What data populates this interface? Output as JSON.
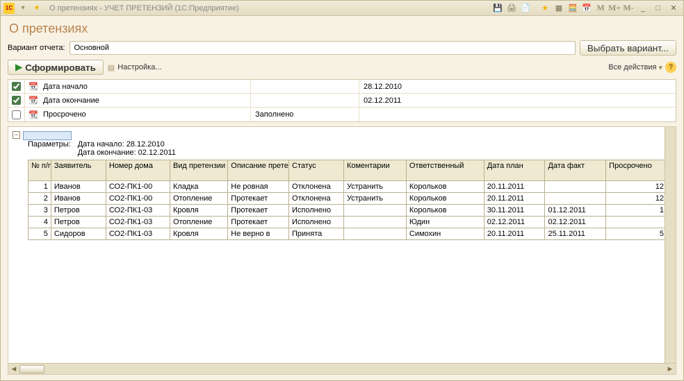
{
  "window": {
    "title": "О претензиях - УЧЕТ ПРЕТЕНЗИЙ  (1С:Предприятие)"
  },
  "page": {
    "title": "О претензиях"
  },
  "variant": {
    "label": "Вариант отчета:",
    "value": "Основной",
    "choose_button": "Выбрать вариант..."
  },
  "toolbar": {
    "form": "Сформировать",
    "settings": "Настройка...",
    "actions": "Все действия"
  },
  "filters": [
    {
      "checked": true,
      "icon": "cal",
      "label": "Дата начало",
      "mid": "",
      "value": "28.12.2010"
    },
    {
      "checked": true,
      "icon": "cal",
      "label": "Дата окончание",
      "mid": "",
      "value": "02.12.2011"
    },
    {
      "checked": false,
      "icon": "cal",
      "label": "Просрочено",
      "mid": "Заполнено",
      "value": ""
    }
  ],
  "params": {
    "title": "Параметры:",
    "line1": "Дата начало: 28.12.2010",
    "line2": "Дата окончание: 02.12.2011"
  },
  "columns": [
    "№ п/п",
    "Заявитель",
    "Номер дома",
    "Вид претензии",
    "Описание претензии",
    "Статус",
    "Коментарии",
    "Ответственный",
    "Дата план",
    "Дата факт",
    "Просрочено"
  ],
  "rows": [
    {
      "n": "1",
      "z": "Иванов",
      "nd": "СО2-ПК1-00",
      "vp": "Кладка",
      "op": "Не ровная",
      "st": "Отклонена",
      "km": "Устранить",
      "ot": "Корольков",
      "dp": "20.11.2011",
      "df": "",
      "pr": "12"
    },
    {
      "n": "2",
      "z": "Иванов",
      "nd": "СО2-ПК1-00",
      "vp": "Отопление",
      "op": "Протекает",
      "st": "Отклонена",
      "km": "Устранить",
      "ot": "Корольков",
      "dp": "20.11.2011",
      "df": "",
      "pr": "12"
    },
    {
      "n": "3",
      "z": "Петров",
      "nd": "СО2-ПК1-03",
      "vp": "Кровля",
      "op": "Протекает",
      "st": "Исполнено",
      "km": "",
      "ot": "Корольков",
      "dp": "30.11.2011",
      "df": "01.12.2011",
      "pr": "1"
    },
    {
      "n": "4",
      "z": "Петров",
      "nd": "СО2-ПК1-03",
      "vp": "Отопление",
      "op": "Протекает",
      "st": "Исполнено",
      "km": "",
      "ot": "Юдин",
      "dp": "02.12.2011",
      "df": "02.12.2011",
      "pr": ""
    },
    {
      "n": "5",
      "z": "Сидоров",
      "nd": "СО2-ПК1-03",
      "vp": "Кровля",
      "op": "Не верно в",
      "st": "Принята",
      "km": "",
      "ot": "Симохин",
      "dp": "20.11.2011",
      "df": "25.11.2011",
      "pr": "5"
    }
  ]
}
